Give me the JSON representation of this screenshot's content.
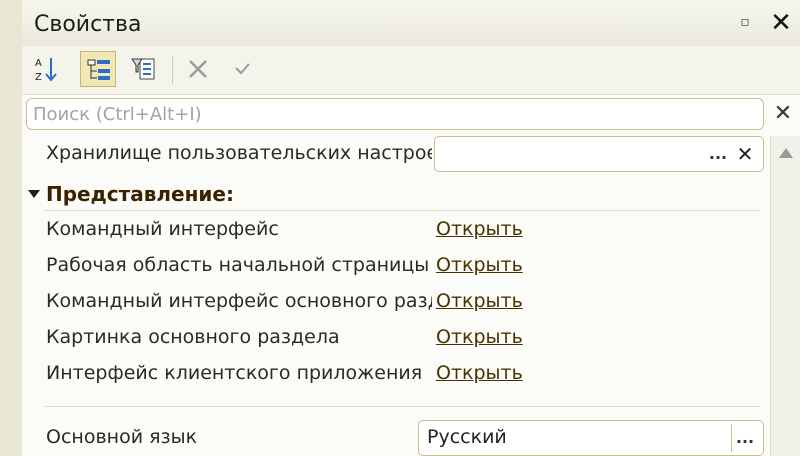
{
  "window": {
    "title": "Свойства",
    "pin_glyph": "▫",
    "close_glyph": "✕"
  },
  "toolbar": {
    "buttons": [
      {
        "name": "sort-alphabetical",
        "icon": "sort-az-icon",
        "pressed": false
      },
      {
        "name": "group-by-category",
        "icon": "category-tree-icon",
        "pressed": true
      },
      {
        "name": "filter",
        "icon": "filter-icon",
        "pressed": false
      },
      {
        "name": "clear",
        "icon": "cross-icon",
        "pressed": false
      },
      {
        "name": "apply",
        "icon": "check-icon",
        "pressed": false
      }
    ]
  },
  "search": {
    "placeholder": "Поиск (Ctrl+Alt+I)",
    "value": "",
    "clear_glyph": "✕"
  },
  "properties": {
    "storage": {
      "label": "Хранилище пользовательских настроек",
      "value": "",
      "select_glyph": "...",
      "clear_glyph": "✕"
    },
    "group": {
      "label": "Представление:",
      "expanded": true
    },
    "items": [
      {
        "label": "Командный интерфейс",
        "action": "Открыть"
      },
      {
        "label": "Рабочая область начальной страницы",
        "action": "Открыть"
      },
      {
        "label": "Командный интерфейс основного раздела",
        "action": "Открыть"
      },
      {
        "label": "Картинка основного раздела",
        "action": "Открыть"
      },
      {
        "label": "Интерфейс клиентского приложения",
        "action": "Открыть"
      }
    ],
    "language": {
      "label": "Основной язык",
      "value": "Русский",
      "select_glyph": "..."
    }
  },
  "colors": {
    "accent_border": "#c9c089",
    "link": "#4a3200",
    "group": "#3c2100",
    "pressed": "#f1e6b6"
  }
}
